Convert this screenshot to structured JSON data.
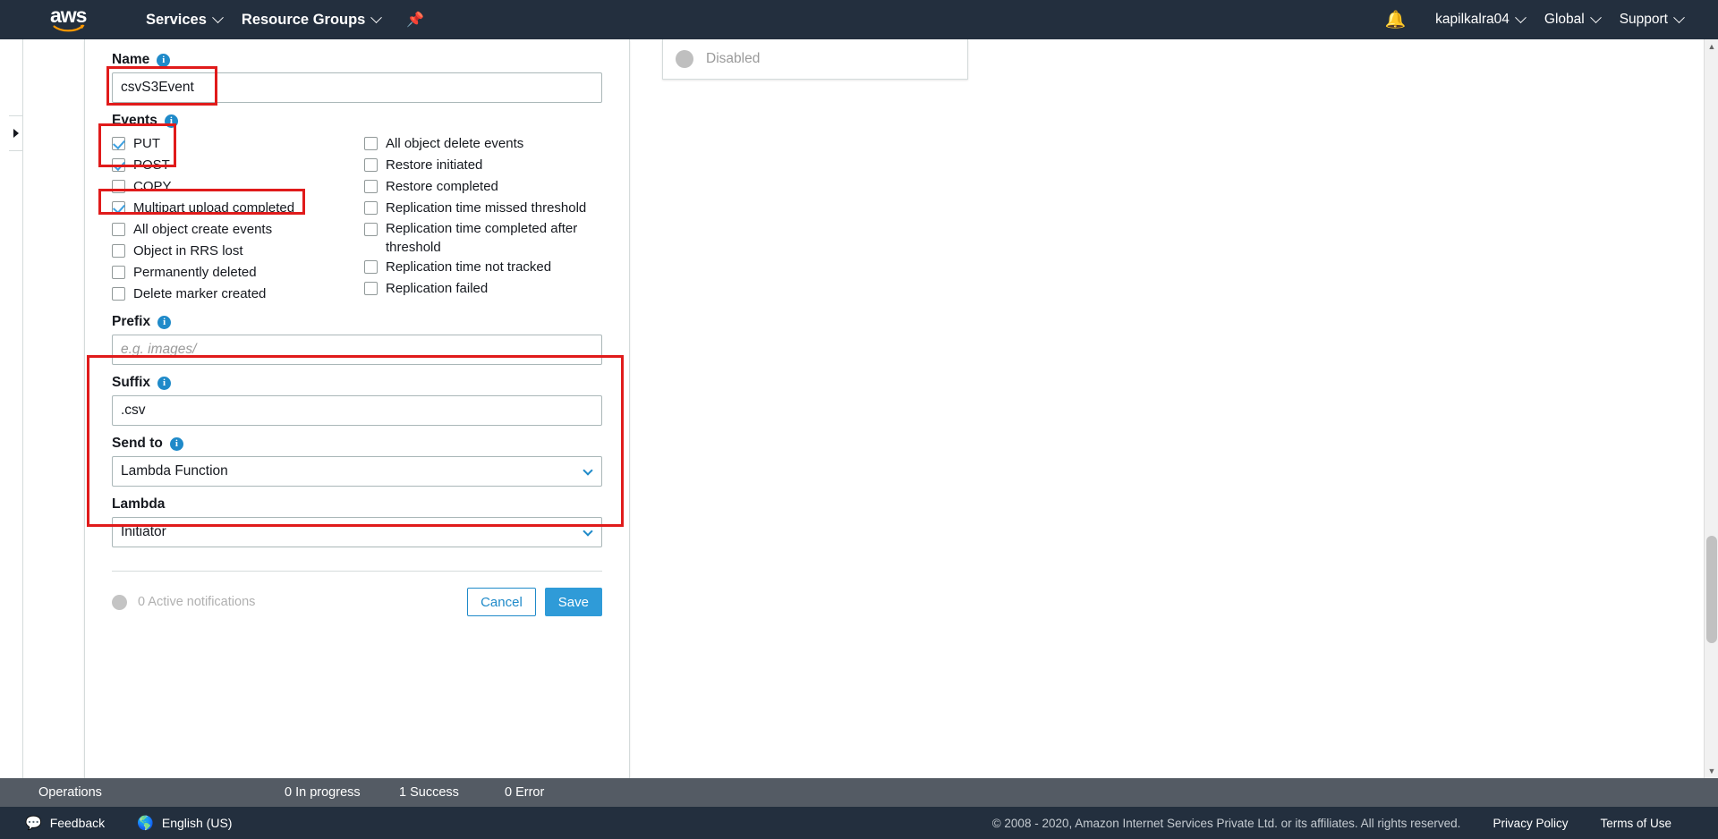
{
  "topnav": {
    "logo_alt": "aws",
    "left_items": [
      {
        "label": "Services",
        "caret": true
      },
      {
        "label": "Resource Groups",
        "caret": true
      }
    ],
    "pin_icon": "pin-icon",
    "bell_icon": "bell-icon",
    "right_items": [
      {
        "label": "kapilkalra04",
        "caret": true
      },
      {
        "label": "Global",
        "caret": true
      },
      {
        "label": "Support",
        "caret": true
      }
    ]
  },
  "form": {
    "name": {
      "label": "Name",
      "value": "csvS3Event",
      "placeholder": ""
    },
    "events": {
      "label": "Events",
      "left_column": [
        {
          "label": "PUT",
          "checked": true
        },
        {
          "label": "POST",
          "checked": true
        },
        {
          "label": "COPY",
          "checked": false
        },
        {
          "label": "Multipart upload completed",
          "checked": true
        },
        {
          "label": "All object create events",
          "checked": false
        },
        {
          "label": "Object in RRS lost",
          "checked": false
        },
        {
          "label": "Permanently deleted",
          "checked": false
        },
        {
          "label": "Delete marker created",
          "checked": false
        }
      ],
      "right_column": [
        {
          "label": "All object delete events",
          "checked": false,
          "tall": false
        },
        {
          "label": "Restore initiated",
          "checked": false,
          "tall": false
        },
        {
          "label": "Restore completed",
          "checked": false,
          "tall": false
        },
        {
          "label": "Replication time missed threshold",
          "checked": false,
          "tall": false
        },
        {
          "label": "Replication time completed after threshold",
          "checked": false,
          "tall": true
        },
        {
          "label": "Replication time not tracked",
          "checked": false,
          "tall": false
        },
        {
          "label": "Replication failed",
          "checked": false,
          "tall": false
        }
      ]
    },
    "prefix": {
      "label": "Prefix",
      "value": "",
      "placeholder": "e.g. images/"
    },
    "suffix": {
      "label": "Suffix",
      "value": ".csv",
      "placeholder": ""
    },
    "send_to": {
      "label": "Send to",
      "value": "Lambda Function"
    },
    "lambda": {
      "label": "Lambda",
      "value": "Initiator"
    },
    "footer": {
      "active_notifications": "0 Active notifications",
      "cancel_label": "Cancel",
      "save_label": "Save"
    }
  },
  "right_panel": {
    "status_label": "Disabled"
  },
  "operations_bar": {
    "title": "Operations",
    "in_progress": "0 In progress",
    "success": "1 Success",
    "error": "0 Error"
  },
  "bottom_bar": {
    "feedback": "Feedback",
    "feedback_icon": "speech-bubble-icon",
    "language": "English (US)",
    "language_icon": "globe-icon",
    "copyright": "© 2008 - 2020, Amazon Internet Services Private Ltd. or its affiliates. All rights reserved.",
    "privacy_policy": "Privacy Policy",
    "terms_of_use": "Terms of Use"
  },
  "colors": {
    "nav_bg": "#232f3e",
    "accent_blue": "#1f8ac9",
    "annotation_red": "#e01b1b",
    "ops_bar_bg": "#545b64"
  }
}
